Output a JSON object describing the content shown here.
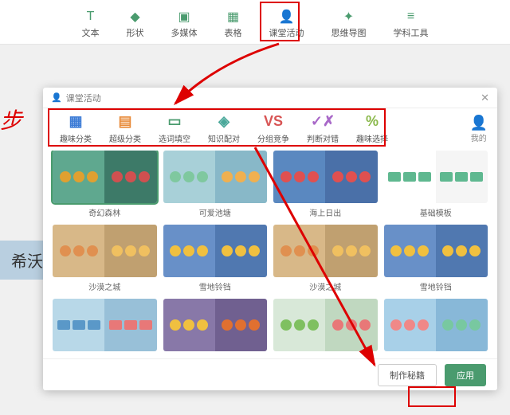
{
  "topbar": {
    "items": [
      {
        "icon": "T",
        "label": "文本"
      },
      {
        "icon": "◆",
        "label": "形状"
      },
      {
        "icon": "▣",
        "label": "多媒体"
      },
      {
        "icon": "▦",
        "label": "表格"
      },
      {
        "icon": "👤",
        "label": "课堂活动"
      },
      {
        "icon": "✦",
        "label": "思维导图"
      },
      {
        "icon": "≡",
        "label": "学科工具"
      }
    ]
  },
  "side": {
    "text": "步",
    "button": "希沃"
  },
  "panel": {
    "title": "课堂活动",
    "tabs": [
      {
        "icon": "▦",
        "label": "趣味分类",
        "cls": "c-blue"
      },
      {
        "icon": "▤",
        "label": "超级分类",
        "cls": "c-orng"
      },
      {
        "icon": "▭",
        "label": "选词填空",
        "cls": "c-grn"
      },
      {
        "icon": "◈",
        "label": "知识配对",
        "cls": "c-teal"
      },
      {
        "icon": "VS",
        "label": "分组竞争",
        "cls": "c-red"
      },
      {
        "icon": "✓✗",
        "label": "判断对错",
        "cls": "c-pur"
      },
      {
        "icon": "%",
        "label": "趣味选择",
        "cls": "c-lime"
      }
    ],
    "me": "我的",
    "cards": [
      {
        "label": "奇幻森林",
        "bgL": "#5fa88f",
        "bgR": "#3d7a68",
        "dotL": "#e0a030",
        "dotR": "#d05050",
        "sel": true
      },
      {
        "label": "可爱池塘",
        "bgL": "#a8d0d8",
        "bgR": "#88b8c8",
        "dotL": "#7fc89f",
        "dotR": "#f0b050"
      },
      {
        "label": "海上日出",
        "bgL": "#5a88c0",
        "bgR": "#4a70a8",
        "dotL": "#e05050",
        "dotR": "#e05050"
      },
      {
        "label": "基础模板",
        "bgL": "#ffffff",
        "bgR": "#f5f5f5",
        "dotL": "#5fb890",
        "dotR": "#5fb890",
        "sq": true
      },
      {
        "label": "沙漠之城",
        "bgL": "#d8b888",
        "bgR": "#c0a070",
        "dotL": "#e09050",
        "dotR": "#f0c060"
      },
      {
        "label": "雪地铃铛",
        "bgL": "#6890c8",
        "bgR": "#5078b0",
        "dotL": "#f0c040",
        "dotR": "#f0c040"
      },
      {
        "label": "沙漠之城",
        "bgL": "#d8b888",
        "bgR": "#c0a070",
        "dotL": "#e09050",
        "dotR": "#f0c060"
      },
      {
        "label": "雪地铃铛",
        "bgL": "#6890c8",
        "bgR": "#5078b0",
        "dotL": "#f0c040",
        "dotR": "#f0c040"
      },
      {
        "label": "",
        "bgL": "#b8d8e8",
        "bgR": "#98c0d8",
        "dotL": "#5a98c8",
        "dotR": "#e87878",
        "sq": true
      },
      {
        "label": "",
        "bgL": "#8878a8",
        "bgR": "#706090",
        "dotL": "#f0c040",
        "dotR": "#e07030"
      },
      {
        "label": "",
        "bgL": "#d8e8d8",
        "bgR": "#c0d8c0",
        "dotL": "#7fc060",
        "dotR": "#e87878"
      },
      {
        "label": "",
        "bgL": "#a8d0e8",
        "bgR": "#88b8d8",
        "dotL": "#f08888",
        "dotR": "#78c8a0"
      }
    ],
    "footer": {
      "ghost": "制作秘籍",
      "primary": "应用"
    }
  }
}
